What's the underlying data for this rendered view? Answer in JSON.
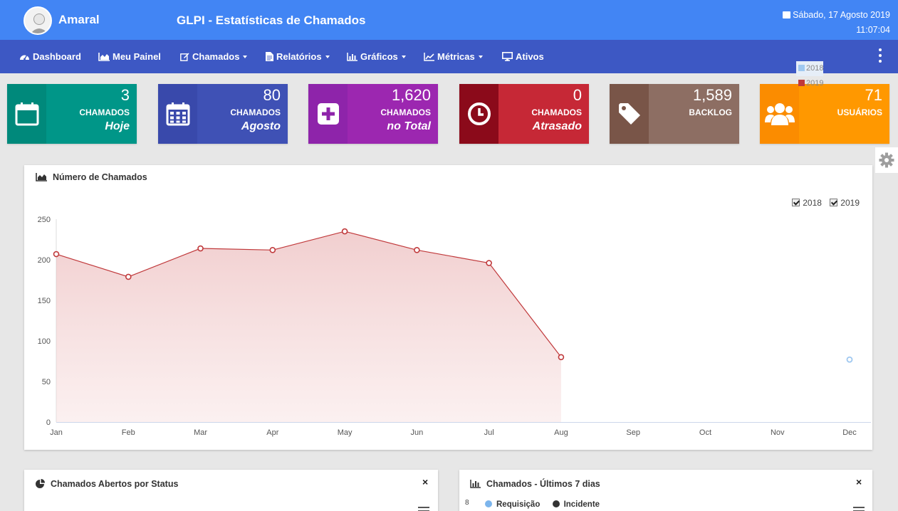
{
  "header": {
    "username": "Amaral",
    "app_title": "GLPI - Estatísticas de Chamados",
    "date": "Sábado, 17 Agosto 2019",
    "time": "11:07:04",
    "bg_color": "#4285f4"
  },
  "nav": {
    "bg_color": "#3d58c4",
    "items": [
      {
        "label": "Dashboard",
        "icon": "dashboard-icon",
        "dropdown": false
      },
      {
        "label": "Meu Painel",
        "icon": "area-chart-icon",
        "dropdown": false
      },
      {
        "label": "Chamados",
        "icon": "edit-icon",
        "dropdown": true
      },
      {
        "label": "Relatórios",
        "icon": "file-icon",
        "dropdown": true
      },
      {
        "label": "Gráficos",
        "icon": "bar-chart-icon",
        "dropdown": true
      },
      {
        "label": "Métricas",
        "icon": "line-chart-icon",
        "dropdown": true
      },
      {
        "label": "Ativos",
        "icon": "desktop-icon",
        "dropdown": false
      }
    ],
    "menu_icon": "kebab-icon"
  },
  "cards": [
    {
      "value": "3",
      "label": "CHAMADOS",
      "sub": "Hoje",
      "icon": "calendar-icon",
      "color": "#009688",
      "icon_bg": "#00897b"
    },
    {
      "value": "80",
      "label": "CHAMADOS",
      "sub": "Agosto",
      "icon": "calendar-grid-icon",
      "color": "#3f51b5",
      "icon_bg": "#3949ab"
    },
    {
      "value": "1,620",
      "label": "CHAMADOS",
      "sub": "no Total",
      "icon": "plus-square-icon",
      "color": "#9c27b0",
      "icon_bg": "#8e24aa"
    },
    {
      "value": "0",
      "label": "CHAMADOS",
      "sub": "Atrasado",
      "icon": "clock-icon",
      "color": "#c62836",
      "icon_bg": "#8b0a1a"
    },
    {
      "value": "1,589",
      "label": "BACKLOG",
      "sub": "",
      "icon": "tag-icon",
      "color": "#8d6e63",
      "icon_bg": "#795548"
    },
    {
      "value": "71",
      "label": "USUÁRIOS",
      "sub": "",
      "icon": "users-icon",
      "color": "#ff9800",
      "icon_bg": "#fb8c00"
    }
  ],
  "main_panel": {
    "title": "Número de Chamados",
    "title_icon": "area-chart-icon",
    "checkboxes": [
      "2018",
      "2019"
    ]
  },
  "chart_data": {
    "type": "area",
    "title": "Número de Chamados",
    "categories": [
      "Jan",
      "Feb",
      "Mar",
      "Apr",
      "May",
      "Jun",
      "Jul",
      "Aug",
      "Sep",
      "Oct",
      "Nov",
      "Dec"
    ],
    "yticks": [
      0,
      50,
      100,
      150,
      200,
      250
    ],
    "ylim": [
      0,
      250
    ],
    "legend_position": "right",
    "series": [
      {
        "name": "2018",
        "color": "#9fc8f0",
        "values": [
          null,
          null,
          null,
          null,
          null,
          null,
          null,
          null,
          null,
          null,
          null,
          77
        ]
      },
      {
        "name": "2019",
        "color": "#c0393b",
        "values": [
          207,
          179,
          214,
          212,
          235,
          212,
          196,
          80,
          null,
          null,
          null,
          null
        ]
      }
    ]
  },
  "panel_status": {
    "title": "Chamados Abertos por Status",
    "title_icon": "pie-chart-icon",
    "close": "×"
  },
  "panel_7days": {
    "title": "Chamados - Últimos 7 dias",
    "title_icon": "bar-chart-icon",
    "close": "×",
    "y_top": "8",
    "legend": [
      {
        "name": "Requisição",
        "color": "#7cb5ec"
      },
      {
        "name": "Incidente",
        "color": "#333333"
      }
    ]
  }
}
